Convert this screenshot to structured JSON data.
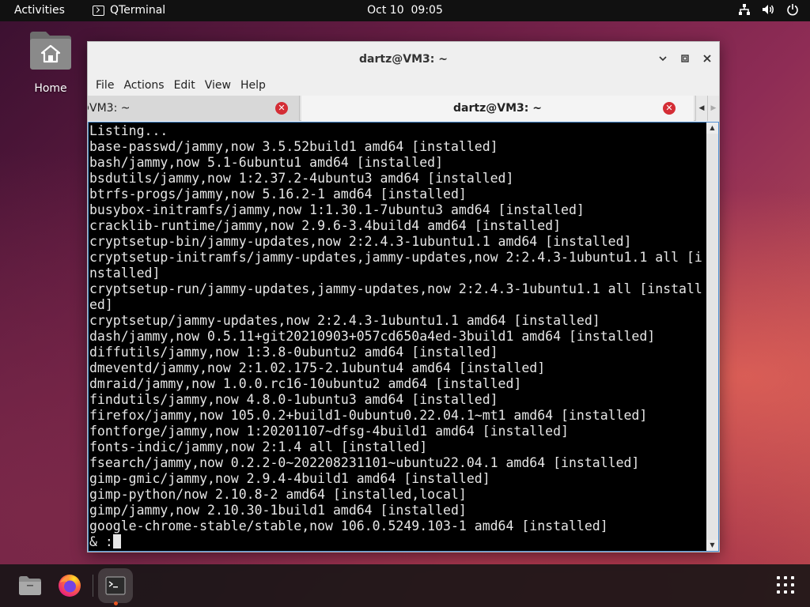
{
  "topbar": {
    "activities": "Activities",
    "app_name": "QTerminal",
    "clock": "Oct 10  09:05",
    "tray_icons": [
      "network-icon",
      "volume-icon",
      "power-icon"
    ]
  },
  "desktop": {
    "home_label": "Home"
  },
  "window": {
    "title": "dartz@VM3: ~",
    "menu": [
      "File",
      "Actions",
      "Edit",
      "View",
      "Help"
    ],
    "tabs": [
      {
        "label": "@VM3: ~",
        "active": false
      },
      {
        "label": "dartz@VM3: ~",
        "active": true
      }
    ],
    "tab_close_glyph": "✕",
    "tab_nav": [
      "◀",
      "▶"
    ]
  },
  "terminal": {
    "lines": [
      "Listing...",
      "base-passwd/jammy,now 3.5.52build1 amd64 [installed]",
      "bash/jammy,now 5.1-6ubuntu1 amd64 [installed]",
      "bsdutils/jammy,now 1:2.37.2-4ubuntu3 amd64 [installed]",
      "btrfs-progs/jammy,now 5.16.2-1 amd64 [installed]",
      "busybox-initramfs/jammy,now 1:1.30.1-7ubuntu3 amd64 [installed]",
      "cracklib-runtime/jammy,now 2.9.6-3.4build4 amd64 [installed]",
      "cryptsetup-bin/jammy-updates,now 2:2.4.3-1ubuntu1.1 amd64 [installed]",
      "cryptsetup-initramfs/jammy-updates,jammy-updates,now 2:2.4.3-1ubuntu1.1 all [i",
      "nstalled]",
      "cryptsetup-run/jammy-updates,jammy-updates,now 2:2.4.3-1ubuntu1.1 all [install",
      "ed]",
      "cryptsetup/jammy-updates,now 2:2.4.3-1ubuntu1.1 amd64 [installed]",
      "dash/jammy,now 0.5.11+git20210903+057cd650a4ed-3build1 amd64 [installed]",
      "diffutils/jammy,now 1:3.8-0ubuntu2 amd64 [installed]",
      "dmeventd/jammy,now 2:1.02.175-2.1ubuntu4 amd64 [installed]",
      "dmraid/jammy,now 1.0.0.rc16-10ubuntu2 amd64 [installed]",
      "findutils/jammy,now 4.8.0-1ubuntu3 amd64 [installed]",
      "firefox/jammy,now 105.0.2+build1-0ubuntu0.22.04.1~mt1 amd64 [installed]",
      "fontforge/jammy,now 1:20201107~dfsg-4build1 amd64 [installed]",
      "fonts-indic/jammy,now 2:1.4 all [installed]",
      "fsearch/jammy,now 0.2.2-0~202208231101~ubuntu22.04.1 amd64 [installed]",
      "gimp-gmic/jammy,now 2.9.4-4build1 amd64 [installed]",
      "gimp-python/now 2.10.8-2 amd64 [installed,local]",
      "gimp/jammy,now 2.10.30-1build1 amd64 [installed]",
      "google-chrome-stable/stable,now 106.0.5249.103-1 amd64 [installed]"
    ],
    "prompt": "& :"
  },
  "dock": {
    "items": [
      "files-icon",
      "firefox-icon",
      "terminal-icon"
    ],
    "apps_grid": "show-apps-icon"
  }
}
